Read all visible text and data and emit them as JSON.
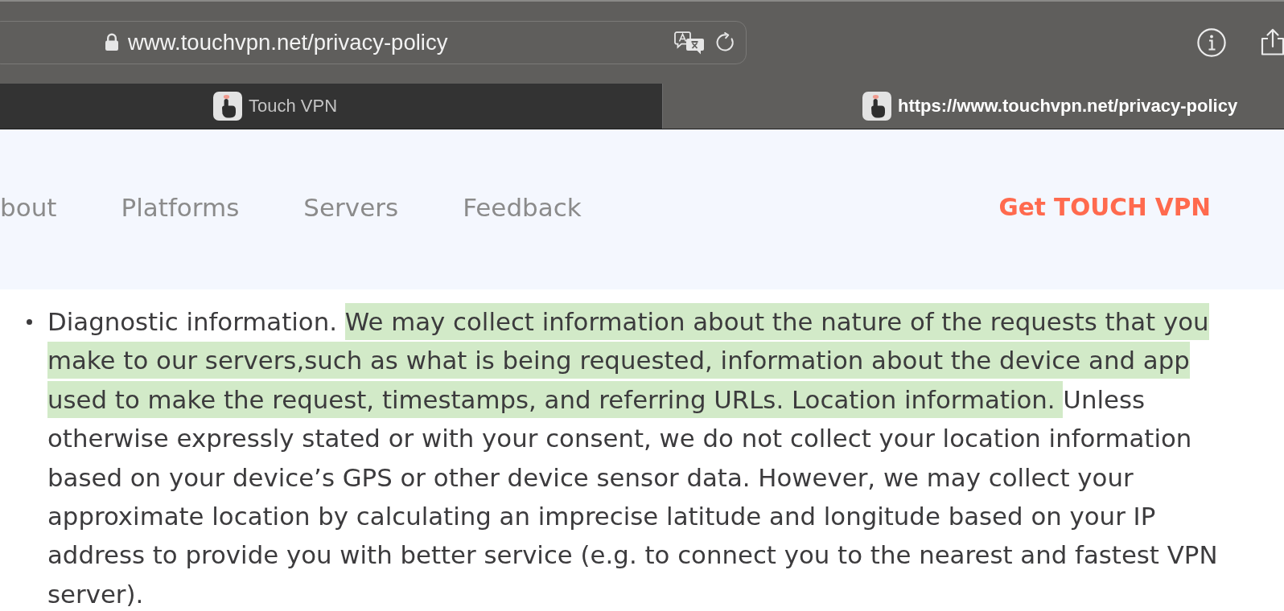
{
  "toolbar": {
    "address": "www.touchvpn.net/privacy-policy",
    "secure": true
  },
  "tabs": [
    {
      "title": "Touch VPN",
      "selected": false
    },
    {
      "title": "https://www.touchvpn.net/privacy-policy",
      "selected": true
    }
  ],
  "site_nav": {
    "links": [
      "bout",
      "Platforms",
      "Servers",
      "Feedback"
    ],
    "cta": "Get TOUCH VPN"
  },
  "content": {
    "list_items": [
      {
        "segments": [
          {
            "text": "Diagnostic information. ",
            "highlighted": false
          },
          {
            "text": "We may collect information about the nature of the requests that you make to our servers,such as what is being requested, information about the device and app used to make the request, timestamps, and referring URLs. Location information. ",
            "highlighted": true
          },
          {
            "text": "Unless otherwise expressly stated or with your consent, we do not collect your location information based on your device’s GPS or other device sensor data. However, we may collect your approximate location by calculating an imprecise latitude and longitude based on your IP address to provide you with better service (e.g. to connect you to the nearest and fastest VPN server).",
            "highlighted": false
          }
        ]
      }
    ]
  }
}
